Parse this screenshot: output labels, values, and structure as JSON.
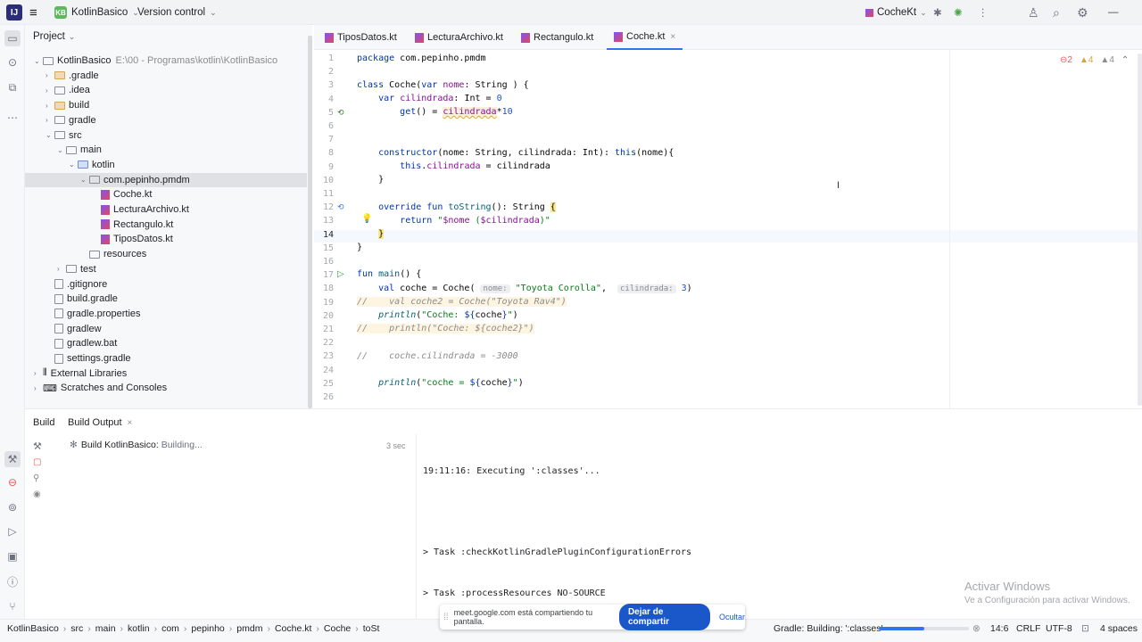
{
  "titlebar": {
    "logo": "IJ",
    "project_badge": "KB",
    "project_name": "KotlinBasico",
    "vcs": "Version control",
    "run_config": "CocheKt"
  },
  "project_panel": {
    "title": "Project",
    "tree": [
      {
        "label": "KotlinBasico",
        "extra": "E:\\00 - Programas\\kotlin\\KotlinBasico",
        "icon": "folder",
        "level": 0,
        "arrow": "v"
      },
      {
        "label": ".gradle",
        "icon": "folder-orange",
        "level": 1,
        "arrow": ">"
      },
      {
        "label": ".idea",
        "icon": "folder",
        "level": 1,
        "arrow": ">"
      },
      {
        "label": "build",
        "icon": "folder-orange",
        "level": 1,
        "arrow": ">"
      },
      {
        "label": "gradle",
        "icon": "folder",
        "level": 1,
        "arrow": ">"
      },
      {
        "label": "src",
        "icon": "folder",
        "level": 1,
        "arrow": "v"
      },
      {
        "label": "main",
        "icon": "folder",
        "level": 2,
        "arrow": "v"
      },
      {
        "label": "kotlin",
        "icon": "folder-blue",
        "level": 3,
        "arrow": "v"
      },
      {
        "label": "com.pepinho.pmdm",
        "icon": "folder",
        "level": 4,
        "arrow": "v"
      },
      {
        "label": "Coche.kt",
        "icon": "kt",
        "level": 5,
        "arrow": ""
      },
      {
        "label": "LecturaArchivo.kt",
        "icon": "kt",
        "level": 5,
        "arrow": ""
      },
      {
        "label": "Rectangulo.kt",
        "icon": "kt",
        "level": 5,
        "arrow": ""
      },
      {
        "label": "TiposDatos.kt",
        "icon": "kt",
        "level": 5,
        "arrow": ""
      },
      {
        "label": "resources",
        "icon": "folder",
        "level": 4,
        "arrow": ""
      },
      {
        "label": "test",
        "icon": "folder",
        "level": 2,
        "arrow": ">"
      },
      {
        "label": ".gitignore",
        "icon": "file",
        "level": 1,
        "arrow": ""
      },
      {
        "label": "build.gradle",
        "icon": "file",
        "level": 1,
        "arrow": ""
      },
      {
        "label": "gradle.properties",
        "icon": "file",
        "level": 1,
        "arrow": ""
      },
      {
        "label": "gradlew",
        "icon": "file",
        "level": 1,
        "arrow": ""
      },
      {
        "label": "gradlew.bat",
        "icon": "file",
        "level": 1,
        "arrow": ""
      },
      {
        "label": "settings.gradle",
        "icon": "file",
        "level": 1,
        "arrow": ""
      },
      {
        "label": "External Libraries",
        "icon": "lib",
        "level": 0,
        "arrow": ">"
      },
      {
        "label": "Scratches and Consoles",
        "icon": "scratch",
        "level": 0,
        "arrow": ">"
      }
    ]
  },
  "editor_tabs": [
    "TiposDatos.kt",
    "LecturaArchivo.kt",
    "Rectangulo.kt",
    "Coche.kt"
  ],
  "editor": {
    "inspections": {
      "errors": "2",
      "warnings": "4",
      "weak": "4"
    },
    "lines": [
      "package com.pepinho.pmdm",
      "",
      "class Coche(var nome: String ) {",
      "    var cilindrada: Int = 0",
      "        get() = cilindrada*10",
      "",
      "",
      "    constructor(nome: String, cilindrada: Int): this(nome){",
      "        this.cilindrada = cilindrada",
      "    }",
      "",
      "    override fun toString(): String {",
      "        return \"$nome ($cilindrada)\"",
      "    }",
      "}",
      "",
      "fun main() {",
      "    val coche = Coche( nome: \"Toyota Corolla\",  cilindrada: 3)",
      "//    val coche2 = Coche(\"Toyota Rav4\")",
      "    println(\"Coche: ${coche}\")",
      "//    println(\"Coche: ${coche2}\")",
      "",
      "//    coche.cilindrada = -3000",
      "",
      "    println(\"coche = ${coche}\")",
      ""
    ]
  },
  "build_panel": {
    "tabs": [
      "Build",
      "Build Output"
    ],
    "task": "Build KotlinBasico:",
    "task_status": "Building...",
    "duration": "3 sec",
    "output": [
      "19:11:16: Executing ':classes'...",
      "",
      "> Task :checkKotlinGradlePluginConfigurationErrors",
      "> Task :processResources NO-SOURCE"
    ]
  },
  "watermark": {
    "title": "Activar Windows",
    "subtitle": "Ve a Configuración para activar Windows."
  },
  "share_bar": {
    "text": "meet.google.com está compartiendo tu pantalla.",
    "stop": "Dejar de compartir",
    "hide": "Ocultar"
  },
  "statusbar": {
    "breadcrumbs": [
      "KotlinBasico",
      "src",
      "main",
      "kotlin",
      "com",
      "pepinho",
      "pmdm",
      "Coche.kt",
      "Coche",
      "toSt"
    ],
    "progress_label": "Gradle: Building: ':classes'",
    "progress": 0.5,
    "position": "14:6",
    "line_sep": "CRLF",
    "encoding": "UTF-8",
    "indent": "4 spaces"
  }
}
